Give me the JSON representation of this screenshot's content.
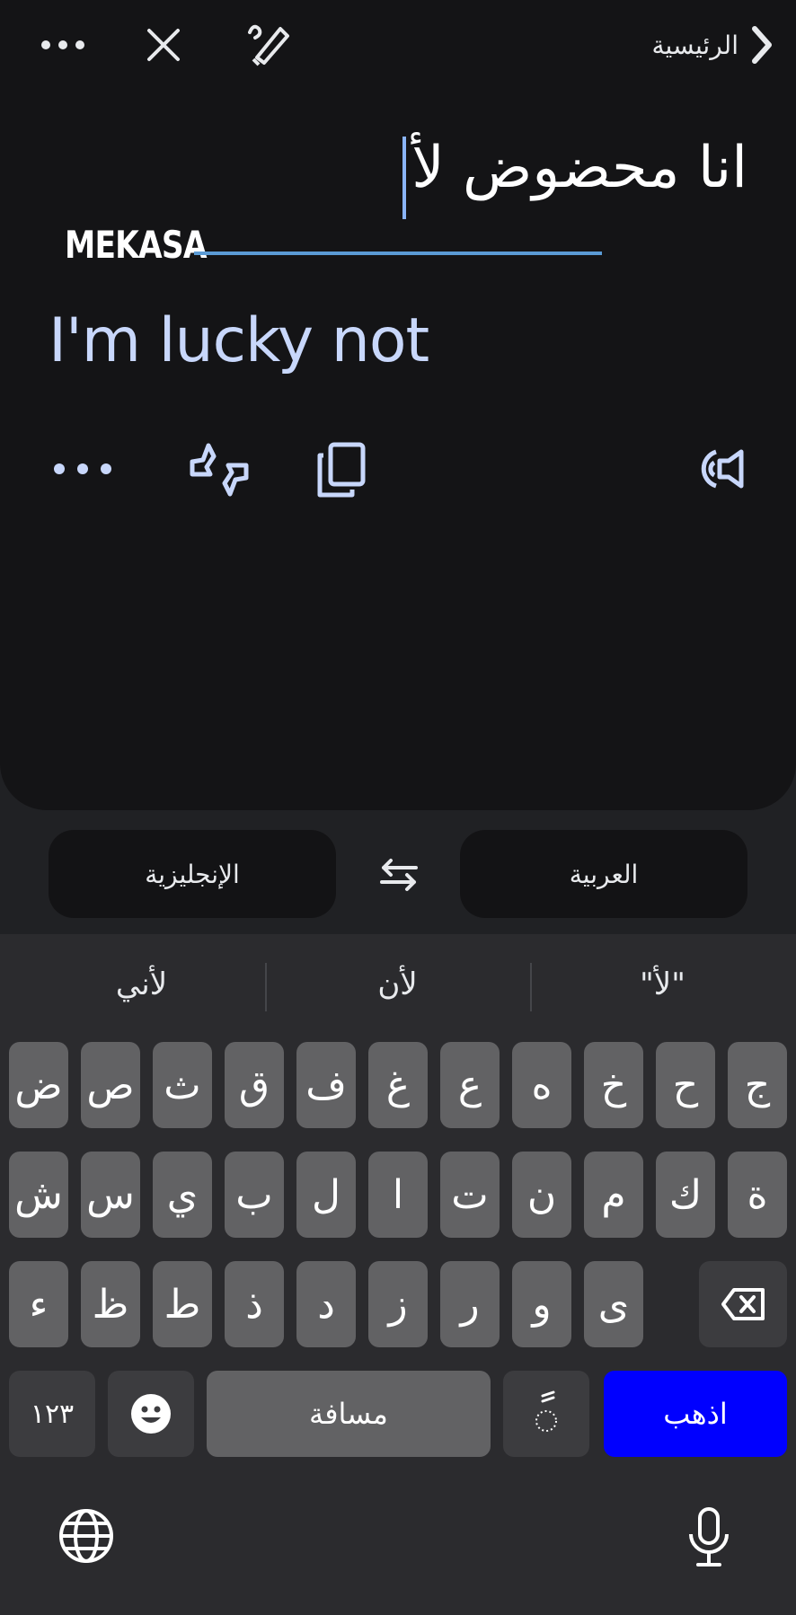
{
  "header": {
    "home_label": "الرئيسية",
    "icons": [
      "chevron-right-icon",
      "handwriting-icon",
      "close-icon",
      "more-icon"
    ]
  },
  "source": {
    "text": "انا محضوض لأ"
  },
  "watermark": "MEKASA",
  "translation": {
    "text": "I'm lucky not",
    "actions": [
      "speaker-icon",
      "copy-icon",
      "feedback-icon",
      "more-icon"
    ]
  },
  "languages": {
    "source": "العربية",
    "target": "الإنجليزية"
  },
  "suggestions": [
    "\"لأ\"",
    "لأن",
    "لأني"
  ],
  "keyboard": {
    "row1": [
      "ج",
      "ح",
      "خ",
      "ه",
      "ع",
      "غ",
      "ف",
      "ق",
      "ث",
      "ص",
      "ض"
    ],
    "row2": [
      "ة",
      "ك",
      "م",
      "ن",
      "ت",
      "ا",
      "ل",
      "ب",
      "ي",
      "س",
      "ش"
    ],
    "row3": [
      "ى",
      "و",
      "ر",
      "ز",
      "د",
      "ذ",
      "ط",
      "ظ",
      "ء"
    ],
    "numbers_label": "١٢٣",
    "space_label": "مسافة",
    "diacritic_label": "ً",
    "go_label": "اذهب",
    "go_color": "#0000ff"
  }
}
